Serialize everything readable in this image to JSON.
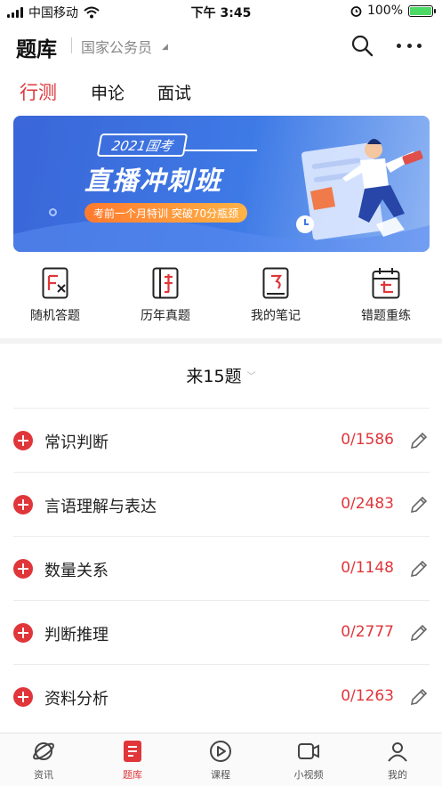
{
  "status_bar": {
    "carrier": "中国移动",
    "time": "下午 3:45",
    "battery": "100%"
  },
  "header": {
    "title": "题库",
    "exam_selector": "国家公务员"
  },
  "tabs": [
    {
      "label": "行测",
      "active": true
    },
    {
      "label": "申论",
      "active": false
    },
    {
      "label": "面试",
      "active": false
    }
  ],
  "banner": {
    "tag": "2021国考",
    "headline": "直播冲刺班",
    "subtitle": "考前一个月特训 突破70分瓶颈"
  },
  "quick_actions": [
    {
      "label": "随机答题",
      "icon": "random-quiz-icon"
    },
    {
      "label": "历年真题",
      "icon": "past-papers-icon"
    },
    {
      "label": "我的笔记",
      "icon": "notes-icon"
    },
    {
      "label": "错题重练",
      "icon": "mistakes-icon"
    }
  ],
  "question_count": "来15题",
  "categories": [
    {
      "name": "常识判断",
      "progress": "0/1586"
    },
    {
      "name": "言语理解与表达",
      "progress": "0/2483"
    },
    {
      "name": "数量关系",
      "progress": "0/1148"
    },
    {
      "name": "判断推理",
      "progress": "0/2777"
    },
    {
      "name": "资料分析",
      "progress": "0/1263"
    }
  ],
  "tab_bar": [
    {
      "label": "资讯",
      "icon": "planet-icon",
      "active": false
    },
    {
      "label": "题库",
      "icon": "question-bank-icon",
      "active": true
    },
    {
      "label": "课程",
      "icon": "play-circle-icon",
      "active": false
    },
    {
      "label": "小视频",
      "icon": "video-icon",
      "active": false
    },
    {
      "label": "我的",
      "icon": "profile-icon",
      "active": false
    }
  ],
  "colors": {
    "accent": "#e0363a",
    "banner": "#3e7ae6"
  }
}
